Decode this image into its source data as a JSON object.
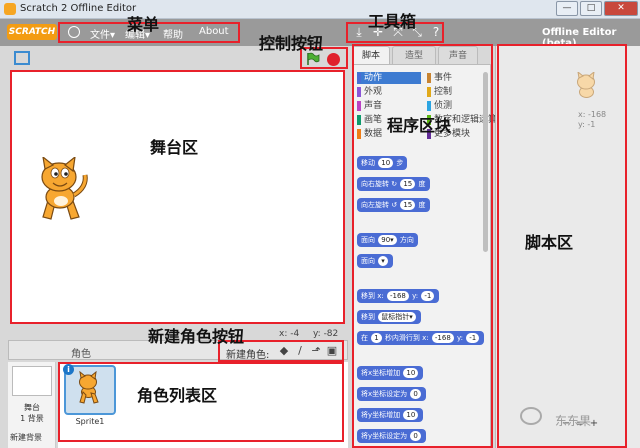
{
  "window": {
    "title": "Scratch 2 Offline Editor",
    "controls": [
      "—",
      "□",
      "✕"
    ]
  },
  "menubar": {
    "logo": "SCRATCH",
    "items": [
      "文件▾",
      "编辑▾",
      "帮助",
      "About"
    ],
    "offline_label": "Offline Editor (beta)",
    "tools": [
      "⤓",
      "✛",
      "⤧",
      "⤡",
      "?"
    ]
  },
  "annotations": {
    "menu": "菜单",
    "toolbox": "工具箱",
    "controls": "控制按钮",
    "stage": "舞台区",
    "palette": "程序区块",
    "scripts": "脚本区",
    "new_sprite": "新建角色按钮",
    "sprite_list": "角色列表区"
  },
  "stage": {
    "coords_x": "x: -4",
    "coords_y": "y: -82"
  },
  "sprites_panel": {
    "header": "角色",
    "new_sprite_label": "新建角色:",
    "stage_label": "舞台",
    "stage_backdrops": "1 背景",
    "new_backdrop": "新建背景",
    "sprites": [
      "Sprite1"
    ]
  },
  "tabs": [
    "脚本",
    "造型",
    "声音"
  ],
  "categories": [
    {
      "label": "动作",
      "color": "#4a6cd4"
    },
    {
      "label": "事件",
      "color": "#c88330"
    },
    {
      "label": "外观",
      "color": "#8a55d7"
    },
    {
      "label": "控制",
      "color": "#e1a91a"
    },
    {
      "label": "声音",
      "color": "#bb42c3"
    },
    {
      "label": "侦测",
      "color": "#2ca5e2"
    },
    {
      "label": "画笔",
      "color": "#0e9a6c"
    },
    {
      "label": "数字和逻辑运算",
      "color": "#5cb712"
    },
    {
      "label": "数据",
      "color": "#ee7d16"
    },
    {
      "label": "更多模块",
      "color": "#632d99"
    }
  ],
  "blocks": [
    {
      "text": "移动",
      "value": "10",
      "suffix": "步"
    },
    {
      "text": "向右旋转",
      "icon": "↻",
      "value": "15",
      "suffix": "度"
    },
    {
      "text": "向左旋转",
      "icon": "↺",
      "value": "15",
      "suffix": "度"
    },
    {
      "text": "面向",
      "value": "90▾",
      "suffix": "方向"
    },
    {
      "text": "面向",
      "value": "▾",
      "suffix": ""
    },
    {
      "text": "移到 x:",
      "value": "-168",
      "text2": "y:",
      "value2": "-1"
    },
    {
      "text": "移到",
      "value": "鼠标指针▾",
      "suffix": ""
    },
    {
      "text": "在",
      "value": "1",
      "text2": "秒内滑行到 x:",
      "value2": "-168",
      "text3": "y:",
      "value3": "-1"
    },
    {
      "text": "将x坐标增加",
      "value": "10"
    },
    {
      "text": "将x坐标设定为",
      "value": "0"
    },
    {
      "text": "将y坐标增加",
      "value": "10"
    },
    {
      "text": "将y坐标设定为",
      "value": "0"
    }
  ],
  "script_area": {
    "x": "x: -168",
    "y": "y: -1"
  },
  "watermark": "东东果"
}
